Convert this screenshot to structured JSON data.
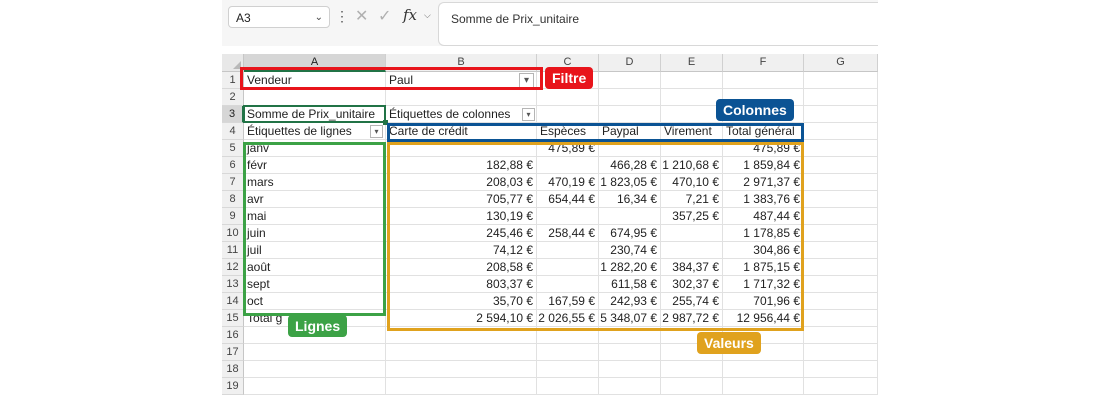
{
  "formula_bar": {
    "name_box": "A3",
    "content": "Somme de Prix_unitaire",
    "fx_label": "fx",
    "cancel_icon": "close-icon",
    "enter_icon": "check-icon"
  },
  "columns": [
    "A",
    "B",
    "C",
    "D",
    "E",
    "F",
    "G"
  ],
  "rows": [
    "1",
    "2",
    "3",
    "4",
    "5",
    "6",
    "7",
    "8",
    "9",
    "10",
    "11",
    "12",
    "13",
    "14",
    "15",
    "16",
    "17",
    "18",
    "19"
  ],
  "filter": {
    "label": "Vendeur",
    "value": "Paul"
  },
  "pivot": {
    "value_field": "Somme de Prix_unitaire",
    "column_labels_header": "Étiquettes de colonnes",
    "row_labels_header": "Étiquettes de lignes",
    "column_items": [
      "Carte de crédit",
      "Espèces",
      "Paypal",
      "Virement",
      "Total général"
    ],
    "rows": [
      {
        "label": "janv",
        "values": [
          "",
          "475,89 €",
          "",
          "",
          "475,89 €"
        ]
      },
      {
        "label": "févr",
        "values": [
          "182,88 €",
          "",
          "466,28 €",
          "1 210,68 €",
          "1 859,84 €"
        ]
      },
      {
        "label": "mars",
        "values": [
          "208,03 €",
          "470,19 €",
          "1 823,05 €",
          "470,10 €",
          "2 971,37 €"
        ]
      },
      {
        "label": "avr",
        "values": [
          "705,77 €",
          "654,44 €",
          "16,34 €",
          "7,21 €",
          "1 383,76 €"
        ]
      },
      {
        "label": "mai",
        "values": [
          "130,19 €",
          "",
          "",
          "357,25 €",
          "487,44 €"
        ]
      },
      {
        "label": "juin",
        "values": [
          "245,46 €",
          "258,44 €",
          "674,95 €",
          "",
          "1 178,85 €"
        ]
      },
      {
        "label": "juil",
        "values": [
          "74,12 €",
          "",
          "230,74 €",
          "",
          "304,86 €"
        ]
      },
      {
        "label": "août",
        "values": [
          "208,58 €",
          "",
          "1 282,20 €",
          "384,37 €",
          "1 875,15 €"
        ]
      },
      {
        "label": "sept",
        "values": [
          "803,37 €",
          "",
          "611,58 €",
          "302,37 €",
          "1 717,32 €"
        ]
      },
      {
        "label": "oct",
        "values": [
          "35,70 €",
          "167,59 €",
          "242,93 €",
          "255,74 €",
          "701,96 €"
        ]
      }
    ],
    "total_label": "Total g",
    "totals": [
      "2 594,10 €",
      "2 026,55 €",
      "5 348,07 €",
      "2 987,72 €",
      "12 956,44 €"
    ]
  },
  "annotations": {
    "filtre": {
      "label": "Filtre",
      "color": "#e8141b"
    },
    "colonnes": {
      "label": "Colonnes",
      "color": "#0b5394"
    },
    "lignes": {
      "label": "Lignes",
      "color": "#3ca246"
    },
    "valeurs": {
      "label": "Valeurs",
      "color": "#e0a21e"
    }
  },
  "colors": {
    "selection": "#217346"
  }
}
